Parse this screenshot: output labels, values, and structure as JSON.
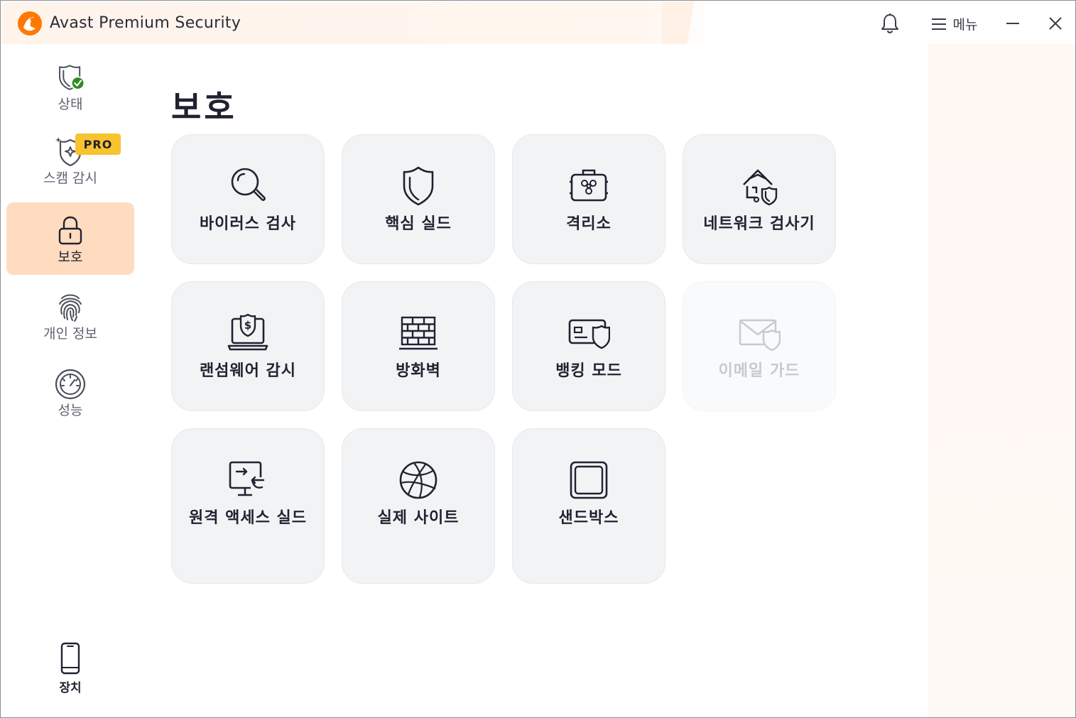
{
  "window": {
    "title": "Avast Premium Security",
    "menu_label": "메뉴"
  },
  "sidebar": {
    "items": [
      {
        "label": "상태",
        "icon": "shield-check-icon"
      },
      {
        "label": "스캠 감시",
        "icon": "shield-sparkle-icon",
        "badge": "PRO"
      },
      {
        "label": "보호",
        "icon": "lock-icon",
        "active": true
      },
      {
        "label": "개인 정보",
        "icon": "fingerprint-icon"
      },
      {
        "label": "성능",
        "icon": "speedometer-icon"
      }
    ],
    "device_label": "장치"
  },
  "main": {
    "title": "보호",
    "tiles": [
      {
        "label": "바이러스 검사",
        "icon": "magnifier-icon"
      },
      {
        "label": "핵심 실드",
        "icon": "shield-icon"
      },
      {
        "label": "격리소",
        "icon": "biohazard-case-icon"
      },
      {
        "label": "네트워크 검사기",
        "icon": "home-network-icon"
      },
      {
        "label": "랜섬웨어 감시",
        "icon": "laptop-dollar-shield-icon"
      },
      {
        "label": "방화벽",
        "icon": "brick-wall-icon"
      },
      {
        "label": "뱅킹 모드",
        "icon": "card-shield-icon"
      },
      {
        "label": "이메일 가드",
        "icon": "mail-shield-icon",
        "disabled": true
      },
      {
        "label": "원격 액세스 실드",
        "icon": "remote-screen-icon"
      },
      {
        "label": "실제 사이트",
        "icon": "globe-icon"
      },
      {
        "label": "샌드박스",
        "icon": "sandbox-icon"
      }
    ]
  },
  "colors": {
    "accent": "#ff7800",
    "active_nav_bg": "#ffdcbf",
    "pro_badge": "#f7c32e",
    "status_ok": "#2e8b1f",
    "tile_bg": "#f2f3f5"
  }
}
